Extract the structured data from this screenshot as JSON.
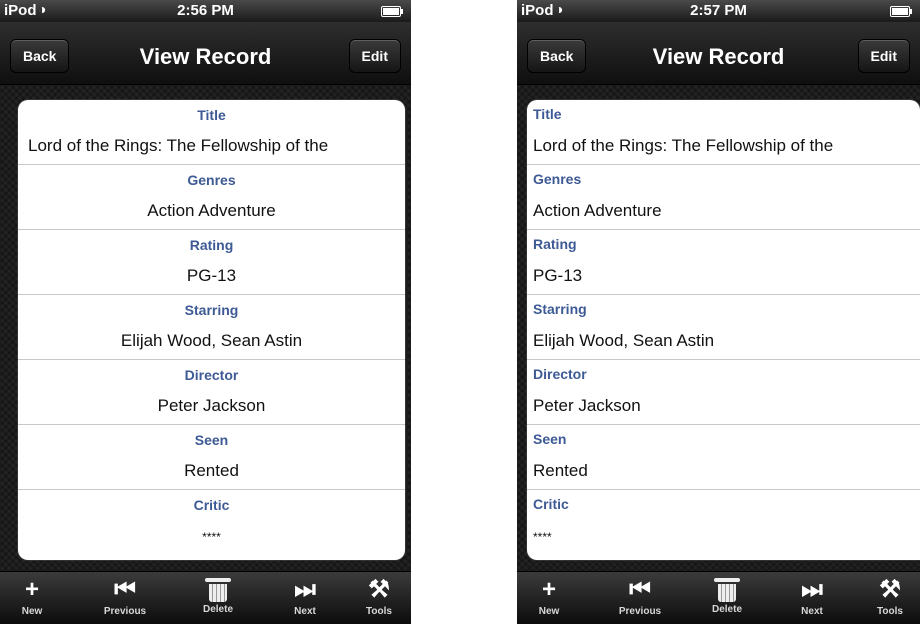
{
  "screens": [
    {
      "statusbar": {
        "carrier": "iPod",
        "time": "2:56 PM"
      },
      "navbar": {
        "back": "Back",
        "title": "View Record",
        "edit": "Edit"
      },
      "fields": [
        {
          "label": "Title",
          "value": "Lord of the Rings: The Fellowship of the"
        },
        {
          "label": "Genres",
          "value": "Action Adventure"
        },
        {
          "label": "Rating",
          "value": "PG-13"
        },
        {
          "label": "Starring",
          "value": "Elijah Wood, Sean Astin"
        },
        {
          "label": "Director",
          "value": "Peter Jackson"
        },
        {
          "label": "Seen",
          "value": "Rented"
        },
        {
          "label": "Critic",
          "value": "****"
        }
      ],
      "toolbar": {
        "new": "New",
        "previous": "Previous",
        "delete": "Delete",
        "next": "Next",
        "tools": "Tools"
      }
    },
    {
      "statusbar": {
        "carrier": "iPod",
        "time": "2:57 PM"
      },
      "navbar": {
        "back": "Back",
        "title": "View Record",
        "edit": "Edit"
      },
      "fields": [
        {
          "label": "Title",
          "value": "Lord of the Rings: The Fellowship of the"
        },
        {
          "label": "Genres",
          "value": "Action Adventure"
        },
        {
          "label": "Rating",
          "value": "PG-13"
        },
        {
          "label": "Starring",
          "value": "Elijah Wood, Sean Astin"
        },
        {
          "label": "Director",
          "value": "Peter Jackson"
        },
        {
          "label": "Seen",
          "value": "Rented"
        },
        {
          "label": "Critic",
          "value": "****"
        }
      ],
      "toolbar": {
        "new": "New",
        "previous": "Previous",
        "delete": "Delete",
        "next": "Next",
        "tools": "Tools"
      }
    }
  ],
  "icons": {
    "wifi": "wifi-icon",
    "battery": "battery-icon",
    "new": "plus-icon",
    "previous": "skip-previous-icon",
    "delete": "trash-icon",
    "next": "skip-next-icon",
    "tools": "tools-icon"
  }
}
